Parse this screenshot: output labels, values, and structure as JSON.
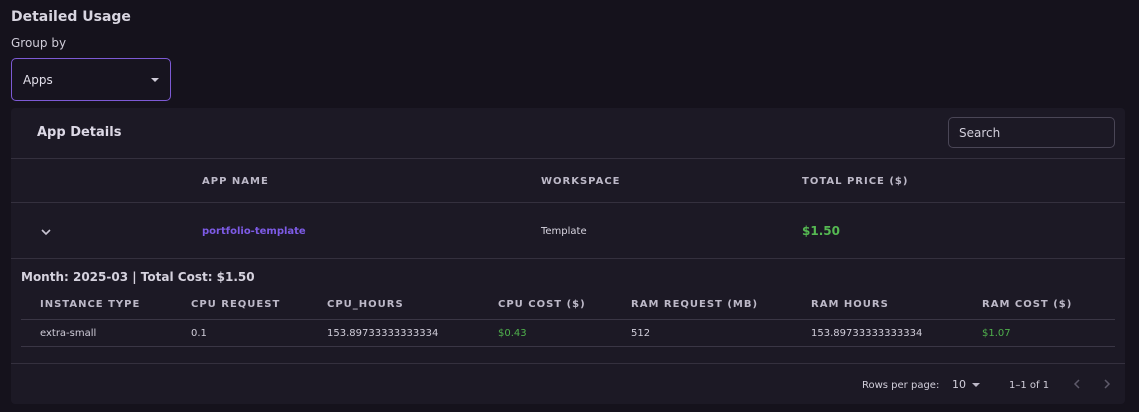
{
  "header": {
    "title": "Detailed Usage",
    "group_by_label": "Group by",
    "group_by_value": "Apps"
  },
  "card": {
    "title": "App Details",
    "search_placeholder": "Search",
    "columns": [
      "APP NAME",
      "WORKSPACE",
      "TOTAL PRICE ($)"
    ],
    "row": {
      "app_name": "portfolio-template",
      "workspace": "Template",
      "total_price": "$1.50"
    },
    "detail": {
      "summary": "Month: 2025-03 | Total Cost: $1.50",
      "columns": [
        "INSTANCE TYPE",
        "CPU REQUEST",
        "CPU_HOURS",
        "CPU COST ($)",
        "RAM REQUEST (MB)",
        "RAM HOURS",
        "RAM COST ($)"
      ],
      "row": [
        "extra-small",
        "0.1",
        "153.89733333333334",
        "$0.43",
        "512",
        "153.89733333333334",
        "$1.07"
      ]
    },
    "footer": {
      "rows_per_page_label": "Rows per page:",
      "rows_per_page_value": "10",
      "range": "1–1 of 1"
    }
  },
  "colors": {
    "accent": "#7d5ad4",
    "money": "#55b852",
    "link": "#7d5be6"
  },
  "icons": {
    "expand": "chevron-down-icon",
    "prev": "chevron-left-icon",
    "next": "chevron-right-icon"
  }
}
